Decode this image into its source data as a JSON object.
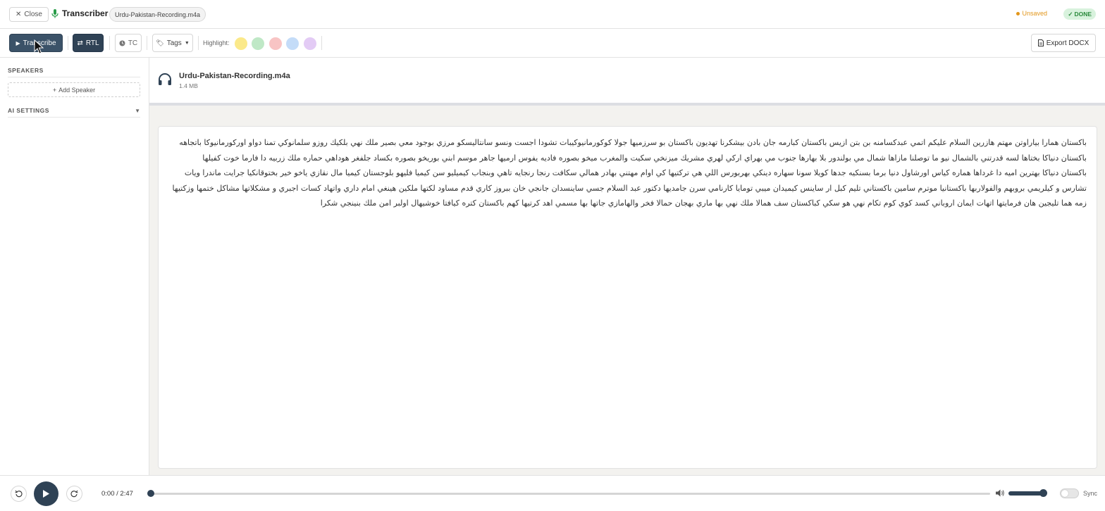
{
  "topbar": {
    "close_label": "Close",
    "app_title": "Transcriber",
    "file_chip": "Urdu-Pakistan-Recording.m4a",
    "unsaved_label": "Unsaved",
    "done_label": "DONE",
    "unsaved_color": "#e2961b",
    "done_color": "#2a8a3c"
  },
  "toolbar": {
    "transcribe_label": "Transcribe",
    "rtl_label": "RTL",
    "tc_label": "TC",
    "tags_label": "Tags",
    "highlight_label": "Highlight:",
    "highlight_colors": [
      "#fbe98a",
      "#bfe8c6",
      "#f8c4c4",
      "#c4dcf8",
      "#e3cbf5"
    ],
    "export_label": "Export DOCX",
    "primary_color": "#2f4255"
  },
  "sidebar": {
    "speakers_heading": "SPEAKERS",
    "add_speaker_label": "Add Speaker",
    "ai_settings_heading": "AI SETTINGS"
  },
  "file": {
    "name": "Urdu-Pakistan-Recording.m4a",
    "size": "1.4 MB"
  },
  "transcript": {
    "lines": [
      "باكستان همارا بياراوتن مهتم هازرين السلام عليكم اتمي عبدكسامنه بن بتن ازيس باكستان كبارمه جان بادن بيشكرنا تهديون باكستان بو سرزميها جولا كوكورمانيوكيبات تشودا اجست ونسو سانتاليسكو مرزي بوجود معي بصير ملك نهي بلكيك روزو سلمانوكي تمنا دواو اوركورمانيوكا باتجاهه",
      "باكستان دنياكا بختاها لسه قدرتني بالشمال نيو ما توصلنا مازاها شمال مي بولندور بلا بهارها جنوب مي بهراي اركي لهري مشريك ميزنخي سكيت والمغرب ميخو بصوره فاديه يفوس ارميها جاهر موسم ابني بوريخو بصوره بكساد جلفغر هوداهي حماره ملك زربيه دا فارما خوت كفيلها",
      "باكستان دنياكا بهترين اميه دا غرداها هماره كياس اورشاول دنيا برما بسنكيه جدها كويلا سونا سهاره دينكي بهربورس اللي هي تركتيها كي اوام مهتني بهادر همالي سكافت رنجا رنجايه تاهي وبنجاب كيميليو سن كيميا فليهو بلوجستان كيميا مال نقازي ياخو خير بختوقانكيا جرايت ماندرا ويات",
      "تشارس و كيلريمي بروبهم والفولاربها باكستانيا موترم سامين باكستاني تليم كبل ار ساينس كيميدان ميبي تومايا كارنامي سرن جامديها دكتور عبد السلام جسي ساينسدان جانجي خان ببروز كاري قدم مساود لكتها ملكين هينغي امام داري واتهاد كسات اجبري و مشكلاتها مشاكل ختمها وزكتيها",
      "زمه هما تليجين هان فرمايتها اتهات ايمان اروباني كسد كوي كوم تكام نهي هو سكي كباكستان سف هماﻻ ملك نهي بها ماري بهجان حماﻻ فخر والهامازي جاتها بها مسمي اهد كرتيها كهم باكستان كتره كيافتا خوشيهال اولبر امن ملك بنينجي شكرا"
    ]
  },
  "player": {
    "time_display": "0:00 / 2:47",
    "sync_label": "Sync",
    "progress": 0,
    "volume": 0.95
  }
}
